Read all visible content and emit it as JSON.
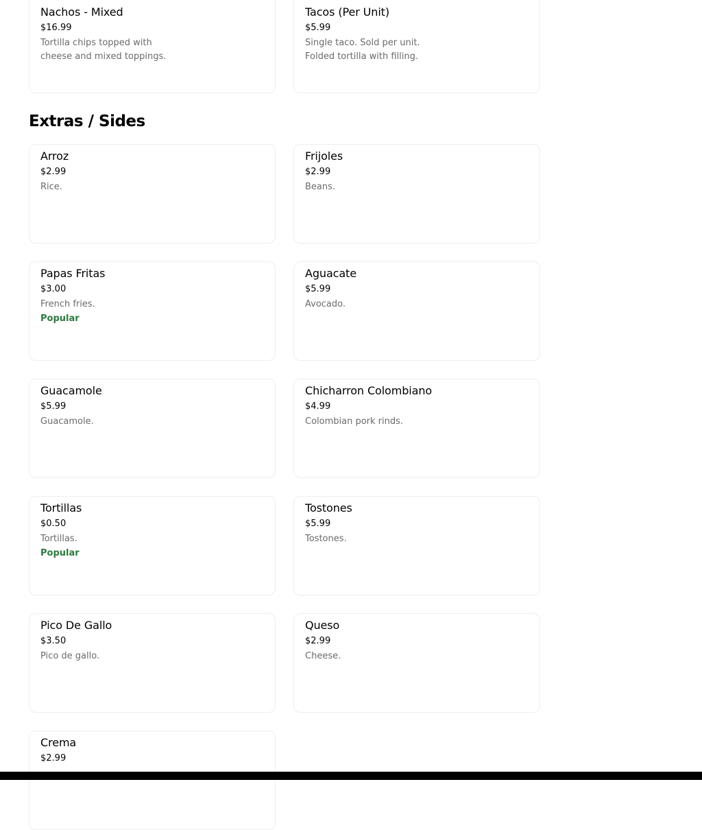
{
  "previous_section": {
    "items": [
      {
        "name": "Nachos - Mixed",
        "price": "$16.99",
        "description": "Tortilla chips topped with cheese and mixed toppings."
      },
      {
        "name": "Tacos (Per Unit)",
        "price": "$5.99",
        "description": "Single taco. Sold per unit. Folded tortilla with filling."
      }
    ]
  },
  "extras_section": {
    "title": "Extras / Sides",
    "items": [
      {
        "name": "Arroz",
        "price": "$2.99",
        "description": "Rice."
      },
      {
        "name": "Frijoles",
        "price": "$2.99",
        "description": "Beans."
      },
      {
        "name": "Papas Fritas",
        "price": "$3.00",
        "description": "French fries.",
        "badge": "Popular"
      },
      {
        "name": "Aguacate",
        "price": "$5.99",
        "description": "Avocado."
      },
      {
        "name": "Guacamole",
        "price": "$5.99",
        "description": "Guacamole."
      },
      {
        "name": "Chicharron Colombiano",
        "price": "$4.99",
        "description": "Colombian pork rinds."
      },
      {
        "name": "Tortillas",
        "price": "$0.50",
        "description": "Tortillas.",
        "badge": "Popular"
      },
      {
        "name": "Tostones",
        "price": "$5.99",
        "description": "Tostones."
      },
      {
        "name": "Pico De Gallo",
        "price": "$3.50",
        "description": "Pico de gallo."
      },
      {
        "name": "Queso",
        "price": "$2.99",
        "description": "Cheese."
      },
      {
        "name": "Crema",
        "price": "$2.99"
      }
    ]
  },
  "colors": {
    "popular_badge": "#2b7a3e",
    "description_text": "#6b6b6b",
    "card_border": "#eeeeee"
  }
}
